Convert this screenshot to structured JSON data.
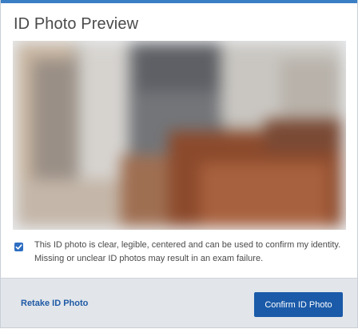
{
  "dialog": {
    "title": "ID Photo Preview",
    "accent_color": "#3a7fc4"
  },
  "photo": {
    "state": "blurred"
  },
  "consent": {
    "checked": true,
    "text": "This ID photo is clear, legible, centered and can be used to confirm my identity. Missing or unclear ID photos may result in an exam failure."
  },
  "footer": {
    "retake_label": "Retake ID Photo",
    "confirm_label": "Confirm ID Photo",
    "primary_color": "#1a5aa8"
  }
}
